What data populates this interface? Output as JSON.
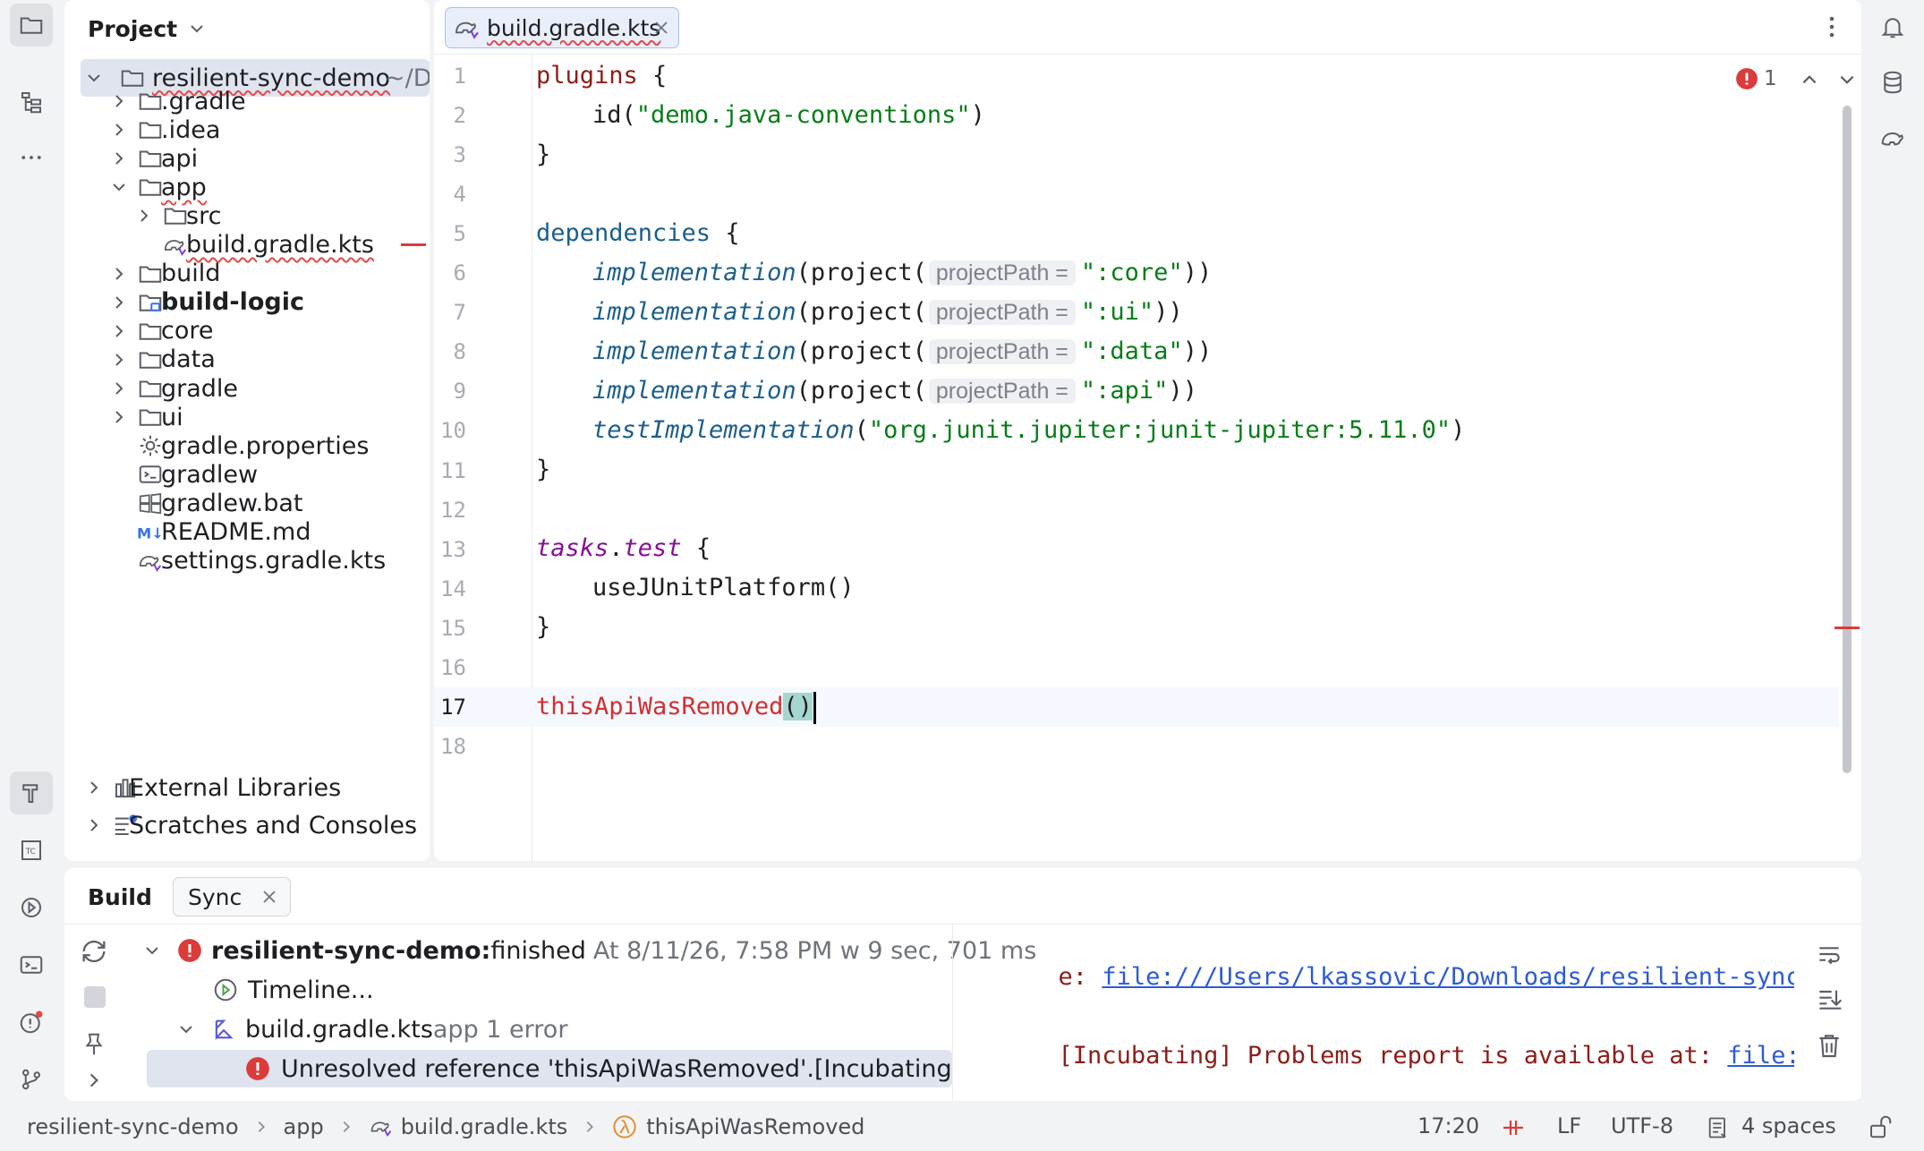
{
  "project_panel": {
    "title": "Project",
    "root": {
      "name": "resilient-sync-demo",
      "path_hint": "~/D"
    },
    "items": [
      {
        "label": ".gradle",
        "type": "folder"
      },
      {
        "label": ".idea",
        "type": "folder"
      },
      {
        "label": "api",
        "type": "folder"
      },
      {
        "label": "app",
        "type": "folder"
      },
      {
        "label": "src",
        "type": "folder"
      },
      {
        "label": "build.gradle.kts",
        "type": "gradle-file"
      },
      {
        "label": "build",
        "type": "folder"
      },
      {
        "label": "build-logic",
        "type": "module-folder"
      },
      {
        "label": "core",
        "type": "folder"
      },
      {
        "label": "data",
        "type": "folder"
      },
      {
        "label": "gradle",
        "type": "folder"
      },
      {
        "label": "ui",
        "type": "folder"
      },
      {
        "label": "gradle.properties",
        "type": "settings-file"
      },
      {
        "label": "gradlew",
        "type": "shell-file"
      },
      {
        "label": "gradlew.bat",
        "type": "windows-file"
      },
      {
        "label": "README.md",
        "type": "markdown-file"
      },
      {
        "label": "settings.gradle.kts",
        "type": "gradle-file"
      }
    ],
    "external_libraries": "External Libraries",
    "scratches": "Scratches and Consoles"
  },
  "editor": {
    "tab_label": "build.gradle.kts",
    "error_count": "1",
    "line_numbers": [
      "1",
      "2",
      "3",
      "4",
      "5",
      "6",
      "7",
      "8",
      "9",
      "10",
      "11",
      "12",
      "13",
      "14",
      "15",
      "16",
      "17",
      "18"
    ],
    "code": {
      "l1_kw": "plugins",
      "l1_brace": " {",
      "l2_fn": "id(",
      "l2_str": "\"demo.java-conventions\"",
      "l2_end": ")",
      "l3": "}",
      "l5_kw": "dependencies",
      "l5_brace": " {",
      "impl": "implementation",
      "project_call": "(project(",
      "hint": "projectPath =",
      "l6_str": "\":core\"",
      "l7_str": "\":ui\"",
      "l8_str": "\":data\"",
      "l9_str": "\":api\"",
      "close2": "))",
      "l10_fn": "testImplementation",
      "l10_open": "(",
      "l10_str": "\"org.junit.jupiter:junit-jupiter:5.11.0\"",
      "l10_close": ")",
      "l11": "}",
      "l13_a": "tasks",
      "l13_dot": ".",
      "l13_b": "test",
      "l13_brace": " {",
      "l14": "useJUnitPlatform()",
      "l15": "}",
      "l17_err": "thisApiWasRemoved",
      "l17_parens": "()"
    }
  },
  "build_panel": {
    "tab_build": "Build",
    "tab_sync": "Sync",
    "tree": {
      "root_label": "resilient-sync-demo:",
      "root_status": " finished",
      "root_time": " At 8/11/26, 7:58 PM w 9 sec, 701 ms",
      "timeline": "Timeline...",
      "file_label": "build.gradle.kts",
      "file_meta": " app 1 error",
      "error_msg": "Unresolved reference 'thisApiWasRemoved'.[Incubating] Prob"
    },
    "console": {
      "line1_prefix": "e: ",
      "line1_link": "file:///Users/lkassovic/Downloads/resilient-sync-demo/app",
      "line2_prefix": "[Incubating] Problems report is available at: ",
      "line2_link": "file:///Users/"
    }
  },
  "status_bar": {
    "breadcrumbs": [
      "resilient-sync-demo",
      "app",
      "build.gradle.kts",
      "thisApiWasRemoved"
    ],
    "position": "17:20",
    "line_ending": "LF",
    "encoding": "UTF-8",
    "indent": "4 spaces"
  }
}
